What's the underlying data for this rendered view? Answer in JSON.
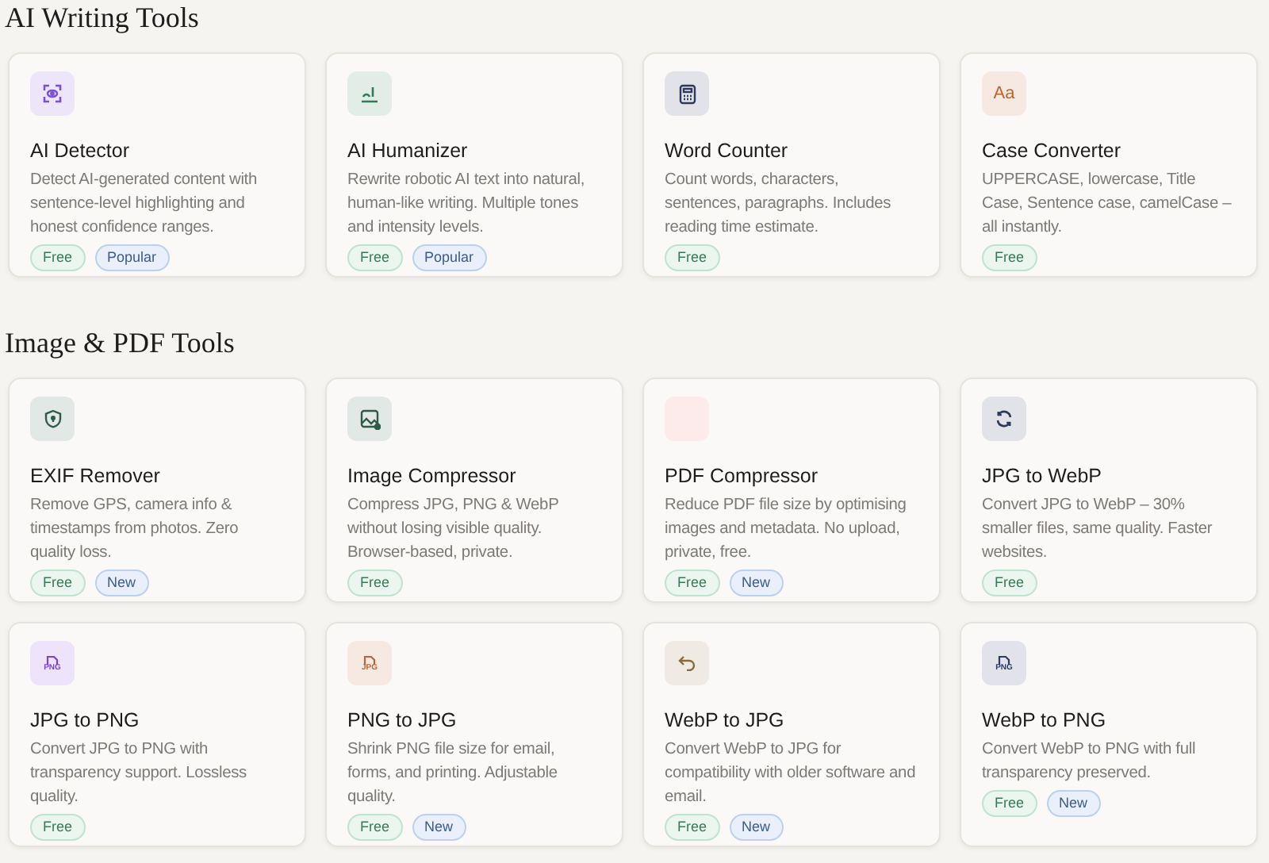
{
  "sections": [
    {
      "title": "AI Writing Tools",
      "tools": [
        {
          "name": "AI Detector",
          "description": "Detect AI-generated content with sentence-level highlighting and honest confidence ranges.",
          "icon": {
            "kind": "scan",
            "color": "#7b4fd8"
          },
          "tags": [
            {
              "label": "Free",
              "kind": "price"
            },
            {
              "label": "Popular",
              "kind": "status"
            }
          ]
        },
        {
          "name": "AI Humanizer",
          "description": "Rewrite robotic AI text into natural, human-like writing. Multiple tones and intensity levels.",
          "icon": {
            "kind": "pen",
            "color": "#2f7d58"
          },
          "tags": [
            {
              "label": "Free",
              "kind": "price"
            },
            {
              "label": "Popular",
              "kind": "status"
            }
          ]
        },
        {
          "name": "Word Counter",
          "description": "Count words, characters, sentences, paragraphs. Includes reading time estimate.",
          "icon": {
            "kind": "calculator",
            "color": "#2d3a5a"
          },
          "tags": [
            {
              "label": "Free",
              "kind": "price"
            }
          ]
        },
        {
          "name": "Case Converter",
          "description": "UPPERCASE, lowercase, Title Case, Sentence case, camelCase – all instantly.",
          "icon": {
            "kind": "text",
            "text": "Aa",
            "color": "#c0622e"
          },
          "tags": [
            {
              "label": "Free",
              "kind": "price"
            }
          ]
        }
      ]
    },
    {
      "title": "Image & PDF Tools",
      "tools": [
        {
          "name": "EXIF Remover",
          "description": "Remove GPS, camera info & timestamps from photos. Zero quality loss.",
          "icon": {
            "kind": "shield",
            "color": "#2f5a48"
          },
          "tags": [
            {
              "label": "Free",
              "kind": "price"
            },
            {
              "label": "New",
              "kind": "status"
            }
          ]
        },
        {
          "name": "Image Compressor",
          "description": "Compress JPG, PNG & WebP without losing visible quality. Browser-based, private.",
          "icon": {
            "kind": "image",
            "color": "#2f5a48"
          },
          "tags": [
            {
              "label": "Free",
              "kind": "price"
            }
          ]
        },
        {
          "name": "PDF Compressor",
          "description": "Reduce PDF file size by optimising images and metadata. No upload, private, free.",
          "icon": {
            "kind": "blank",
            "color": "#fdeaea"
          },
          "tags": [
            {
              "label": "Free",
              "kind": "price"
            },
            {
              "label": "New",
              "kind": "status"
            }
          ]
        },
        {
          "name": "JPG to WebP",
          "description": "Convert JPG to WebP – 30% smaller files, same quality. Faster websites.",
          "icon": {
            "kind": "refresh",
            "color": "#2d3a5a"
          },
          "tags": [
            {
              "label": "Free",
              "kind": "price"
            }
          ]
        },
        {
          "name": "JPG to PNG",
          "description": "Convert JPG to PNG with transparency support. Lossless quality.",
          "icon": {
            "kind": "file",
            "text": "PNG",
            "color": "#7b3fe0"
          },
          "tags": [
            {
              "label": "Free",
              "kind": "price"
            }
          ]
        },
        {
          "name": "PNG to JPG",
          "description": "Shrink PNG file size for email, forms, and printing. Adjustable quality.",
          "icon": {
            "kind": "file",
            "text": "JPG",
            "color": "#c0622e"
          },
          "tags": [
            {
              "label": "Free",
              "kind": "price"
            },
            {
              "label": "New",
              "kind": "status"
            }
          ]
        },
        {
          "name": "WebP to JPG",
          "description": "Convert WebP to JPG for compatibility with older software and email.",
          "icon": {
            "kind": "undo",
            "color": "#8a6a3a"
          },
          "tags": [
            {
              "label": "Free",
              "kind": "price"
            },
            {
              "label": "New",
              "kind": "status"
            }
          ]
        },
        {
          "name": "WebP to PNG",
          "description": "Convert WebP to PNG with full transparency preserved.",
          "icon": {
            "kind": "file",
            "text": "PNG",
            "color": "#2d3a6a"
          },
          "tags": [
            {
              "label": "Free",
              "kind": "price"
            },
            {
              "label": "New",
              "kind": "status"
            }
          ]
        }
      ]
    }
  ]
}
